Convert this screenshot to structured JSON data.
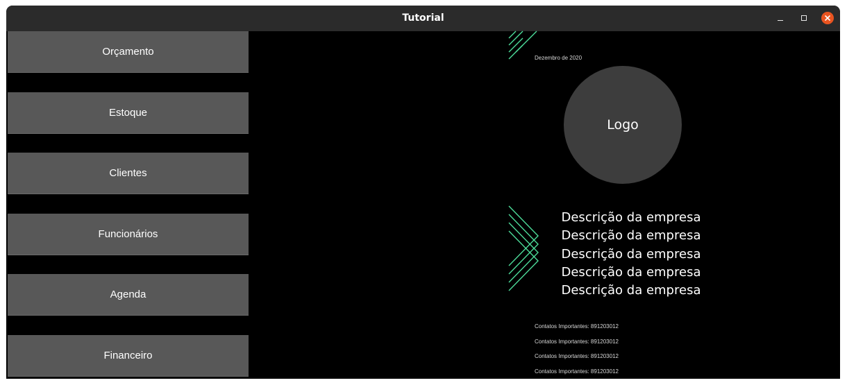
{
  "window": {
    "title": "Tutorial",
    "controls": [
      "minimize",
      "maximize",
      "close"
    ]
  },
  "menu": {
    "items": [
      {
        "label": "Orçamento"
      },
      {
        "label": "Estoque"
      },
      {
        "label": "Clientes"
      },
      {
        "label": "Funcionários"
      },
      {
        "label": "Agenda"
      },
      {
        "label": "Financeiro"
      }
    ]
  },
  "preview": {
    "date": "Dezembro de 2020",
    "logo_label": "Logo",
    "description_lines": [
      "Descrição da empresa",
      "Descrição da empresa",
      "Descrição da empresa",
      "Descrição da empresa",
      "Descrição da empresa"
    ],
    "contacts": [
      "Contatos Importantes: 891203012",
      "Contatos Importantes: 891203012",
      "Contatos Importantes: 891203012",
      "Contatos Importantes: 891203012"
    ]
  },
  "colors": {
    "accent": "#4ddc9a",
    "close_button": "#e95420",
    "menu_button": "#585858",
    "logo_circle": "#3d3d3d",
    "background": "#000000"
  }
}
